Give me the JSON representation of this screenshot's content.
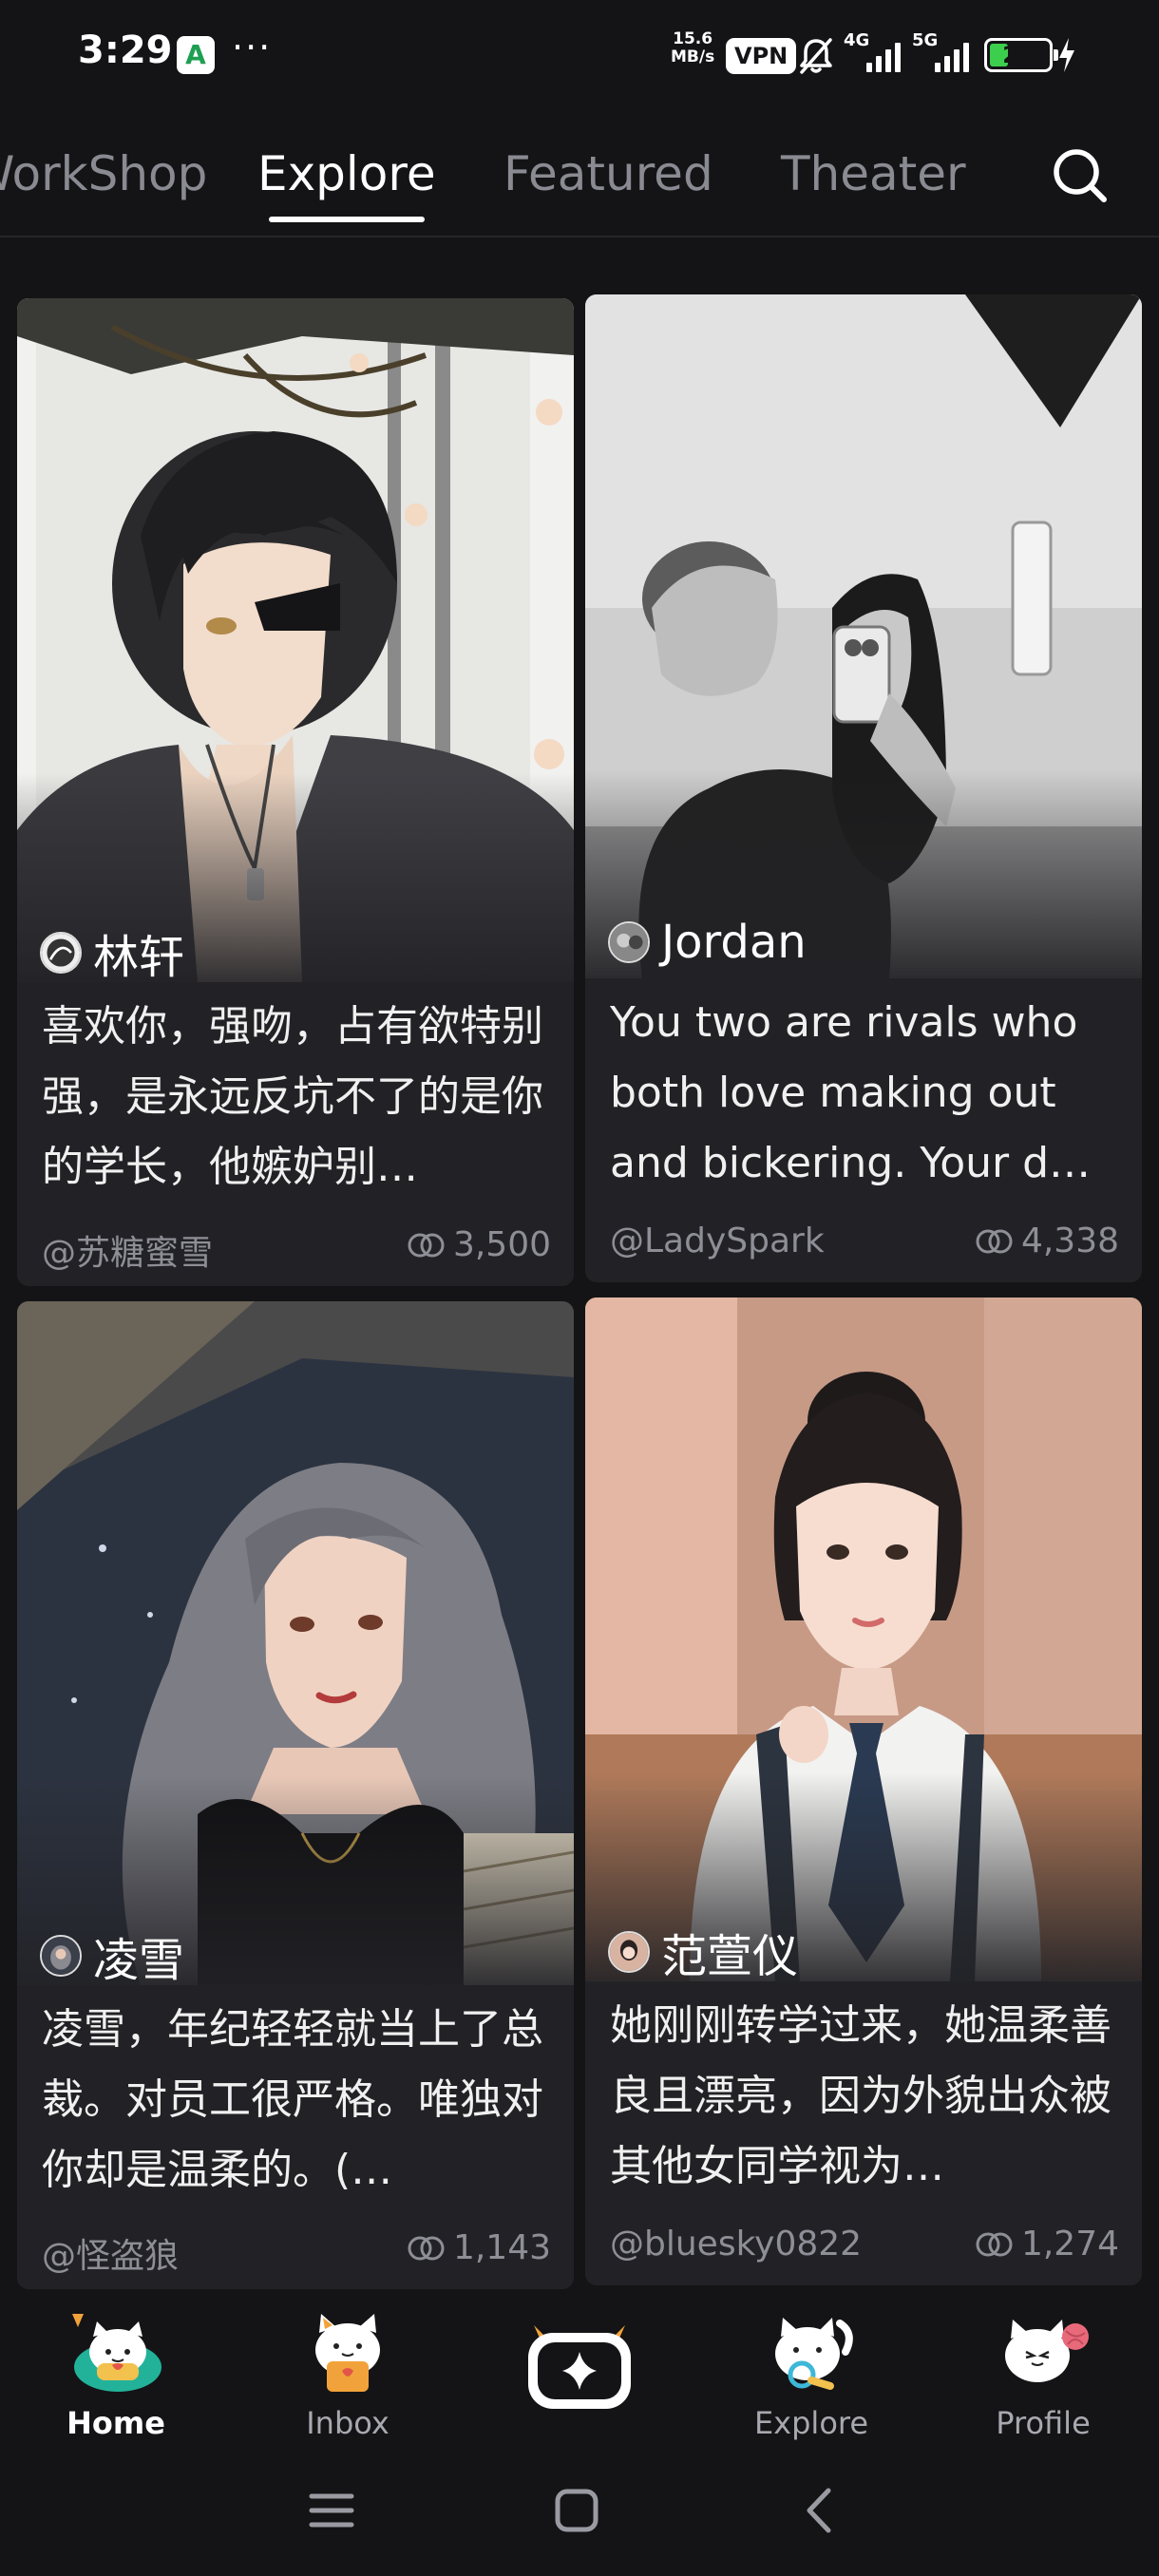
{
  "status_bar": {
    "time": "3:29",
    "app_badge": "A",
    "more": "···",
    "net_speed_value": "15.6",
    "net_speed_unit": "MB/s",
    "vpn": "VPN",
    "signal_1": "4G",
    "signal_2": "5G",
    "battery_percent": "29"
  },
  "tabs": [
    {
      "label": "WorkShop"
    },
    {
      "label": "Explore"
    },
    {
      "label": "Featured"
    },
    {
      "label": "Theater"
    }
  ],
  "active_tab": "Explore",
  "cards": [
    {
      "name": "林轩",
      "description": "喜欢你，强吻，占有欲特别强，是永远反坑不了的是你的学长，他嫉妒别…",
      "creator": "@苏糖蜜雪",
      "count": "3,500"
    },
    {
      "name": "Jordan",
      "description": "You two are rivals who both love making out and bickering. Your d…",
      "creator": "@LadySpark",
      "count": "4,338"
    },
    {
      "name": "凌雪",
      "description": "凌雪，年纪轻轻就当上了总裁。对员工很严格。唯独对你却是温柔的。(…",
      "creator": "@怪盗狼",
      "count": "1,143"
    },
    {
      "name": "范萱仪",
      "description": "她刚刚转学过来，她温柔善良且漂亮，因为外貌出众被其他女同学视为…",
      "creator": "@bluesky0822",
      "count": "1,274"
    }
  ],
  "bottom_nav": [
    {
      "label": "Home",
      "icon": "cat-mascot-home-icon"
    },
    {
      "label": "Inbox",
      "icon": "cat-mascot-inbox-icon"
    },
    {
      "label": "",
      "icon": "sparkle-create-icon"
    },
    {
      "label": "Explore",
      "icon": "cat-mascot-explore-icon"
    },
    {
      "label": "Profile",
      "icon": "cat-mascot-profile-icon"
    }
  ],
  "colors": {
    "background": "#141416",
    "card": "#222226",
    "muted_text": "#8e8e96",
    "accent_orange": "#f2a23a",
    "battery_green": "#3ccf4e"
  }
}
